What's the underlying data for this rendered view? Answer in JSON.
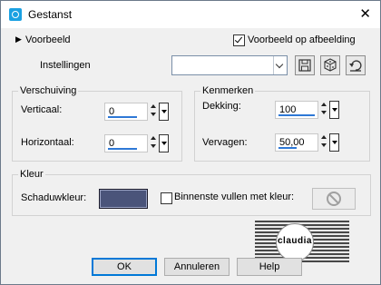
{
  "window": {
    "title": "Gestanst"
  },
  "header": {
    "preview_label": "Voorbeeld",
    "preview_on_image_label": "Voorbeeld op afbeelding",
    "preview_on_image_checked": true,
    "settings_label": "Instellingen",
    "settings_value": ""
  },
  "offset": {
    "group_label": "Verschuiving",
    "vertical_label": "Verticaal:",
    "vertical_value": "0",
    "horizontal_label": "Horizontaal:",
    "horizontal_value": "0"
  },
  "props": {
    "group_label": "Kenmerken",
    "opacity_label": "Dekking:",
    "opacity_value": "100",
    "opacity_level": 1.0,
    "blur_label": "Vervagen:",
    "blur_value": "50,00",
    "blur_level": 0.5
  },
  "color": {
    "group_label": "Kleur",
    "shadow_color_label": "Schaduwkleur:",
    "shadow_color": "#4a547a",
    "fill_inner_label": "Binnenste vullen met kleur:",
    "fill_inner_checked": false
  },
  "buttons": {
    "ok": "OK",
    "cancel": "Annuleren",
    "help": "Help"
  },
  "watermark": {
    "text": "claudia"
  }
}
